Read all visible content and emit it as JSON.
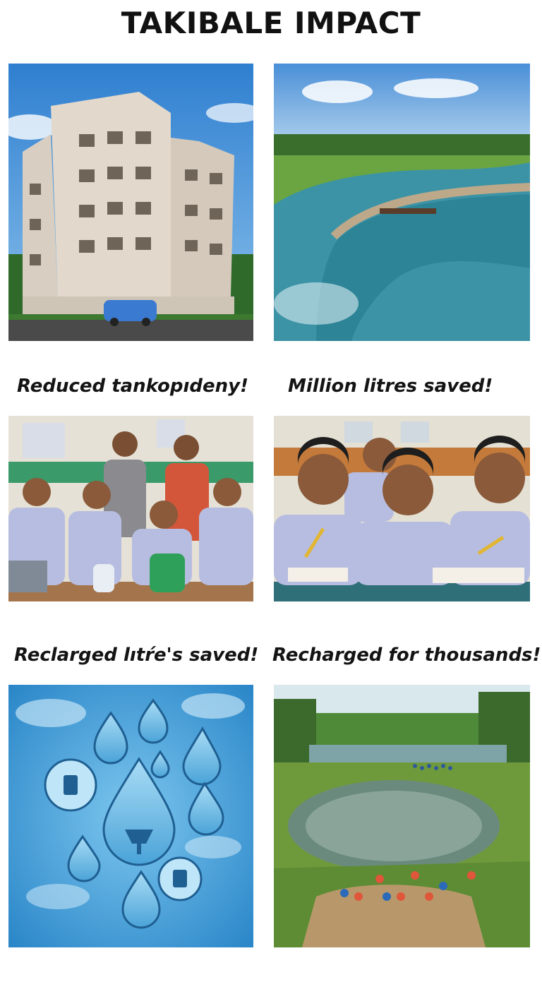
{
  "page": {
    "title": "TAKIBALE IMPACT"
  },
  "captions": [
    "Reduced tankopıdeny!",
    "Million litres saved!",
    "Reclarged lıtŕe's saved!",
    "Recharged for thousands!"
  ],
  "colors": {
    "title_text": "#111111",
    "caption_text": "#141414",
    "sky_blue": "#3f8fd0",
    "water_teal": "#3c93a6",
    "grass_green": "#5f9a36",
    "uniform_lavender": "#b7bde0"
  }
}
